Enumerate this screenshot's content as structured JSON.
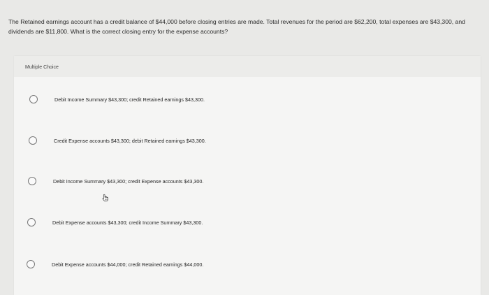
{
  "question": {
    "text": "The Retained earnings account has a credit balance of $44,000 before closing entries are made. Total revenues for the period are $62,200, total expenses are $43,300, and dividends are $11,800. What is the correct closing entry for the expense accounts?"
  },
  "multiple_choice": {
    "label": "Multiple Choice",
    "options": [
      {
        "label": "Debit Income Summary $43,300; credit Retained earnings $43,300."
      },
      {
        "label": "Credit Expense accounts $43,300; debit Retained earnings $43,300."
      },
      {
        "label": "Debit Income Summary $43,300; credit Expense accounts $43,300."
      },
      {
        "label": "Debit Expense accounts $43,300; credit Income Summary $43,300."
      },
      {
        "label": "Debit Expense accounts $44,000; credit Retained earnings $44,000."
      }
    ]
  },
  "colors": {
    "background": "#e9e9e7",
    "panel": "#f5f5f4",
    "radio_border": "#777777"
  },
  "icons": {
    "cursor": "hand-pointer-icon"
  }
}
